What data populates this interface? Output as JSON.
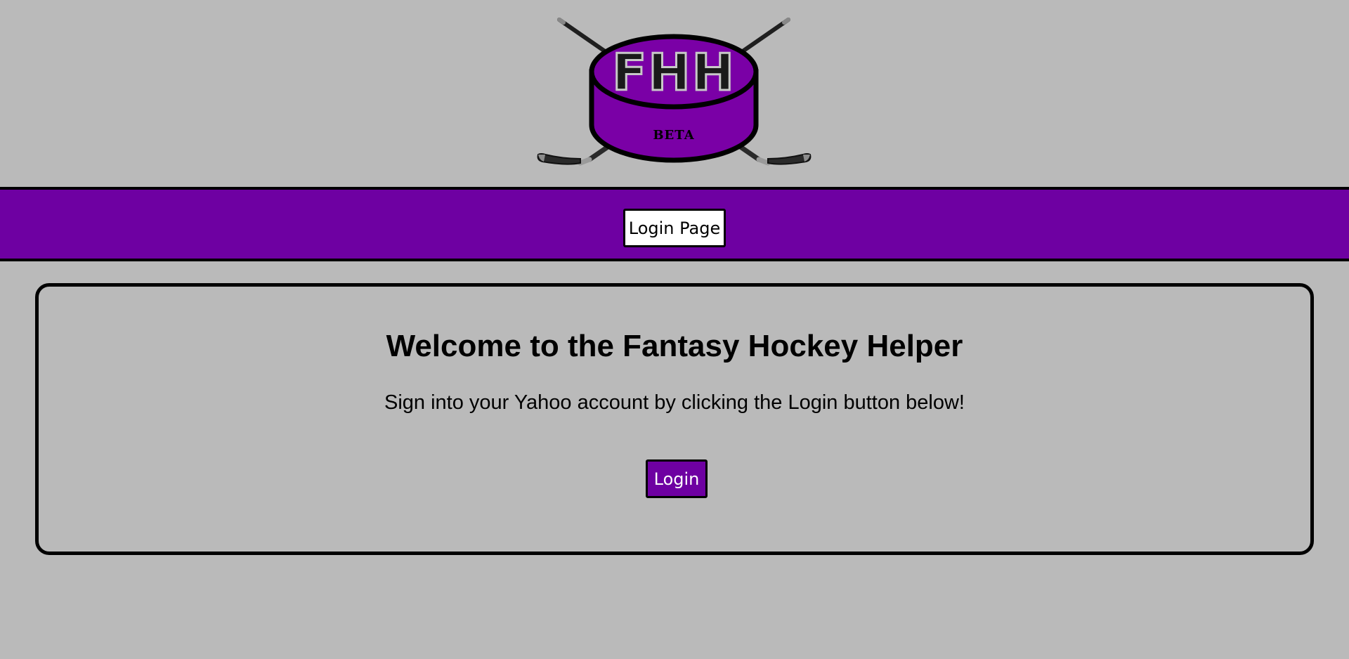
{
  "logo": {
    "text": "FHH",
    "badge": "BETA",
    "colors": {
      "puck": "#7a00a6",
      "outline": "#000000",
      "stick": "#2b2b2b",
      "letters": "#1a1a1a"
    }
  },
  "nav": {
    "login_page_label": "Login Page"
  },
  "main": {
    "title": "Welcome to the Fantasy Hockey Helper",
    "subtitle": "Sign into your Yahoo account by clicking the Login button below!",
    "login_label": "Login"
  },
  "colors": {
    "background": "#bababa",
    "accent": "#6e00a2",
    "border": "#000000"
  }
}
